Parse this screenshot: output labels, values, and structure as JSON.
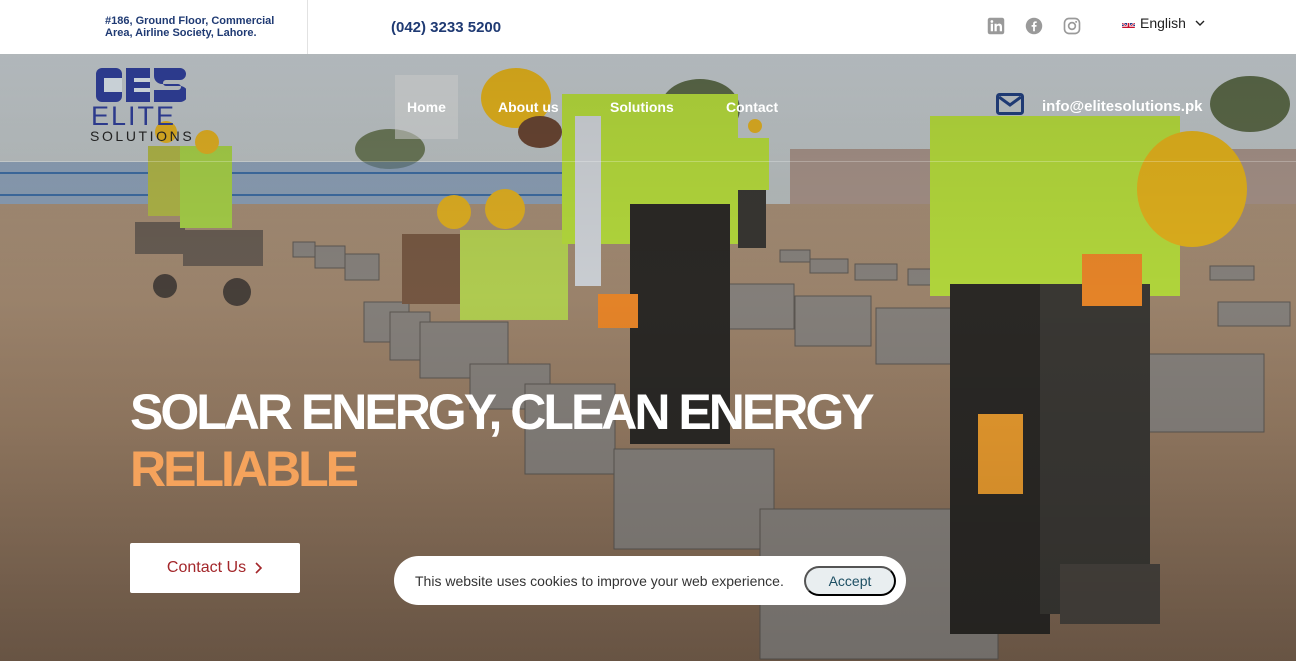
{
  "topbar": {
    "address": "#186, Ground Floor, Commercial Area, Airline Society, Lahore.",
    "phone": "(042) 3233 5200",
    "social": [
      {
        "icon": "linkedin-icon"
      },
      {
        "icon": "facebook-icon"
      },
      {
        "icon": "instagram-icon"
      }
    ],
    "language": "English"
  },
  "logo": {
    "word": "ELITE",
    "sub": "SOLUTIONS"
  },
  "nav": {
    "items": [
      {
        "label": "Home",
        "active": true
      },
      {
        "label": "About us",
        "active": false
      },
      {
        "label": "Solutions",
        "active": false
      },
      {
        "label": "Contact",
        "active": false
      }
    ],
    "email": "info@elitesolutions.pk"
  },
  "hero": {
    "headline_line1": "SOLAR ENERGY, CLEAN ENERGY",
    "headline_line2": "RELIABLE",
    "cta_label": "Contact Us"
  },
  "cookie": {
    "text": "This website uses cookies to improve your web experience.",
    "accept_label": "Accept"
  },
  "colors": {
    "brand_blue": "#1f3a73",
    "logo_blue": "#2c3a8c",
    "accent_orange": "#f5a35c",
    "cta_red": "#a3262a"
  }
}
